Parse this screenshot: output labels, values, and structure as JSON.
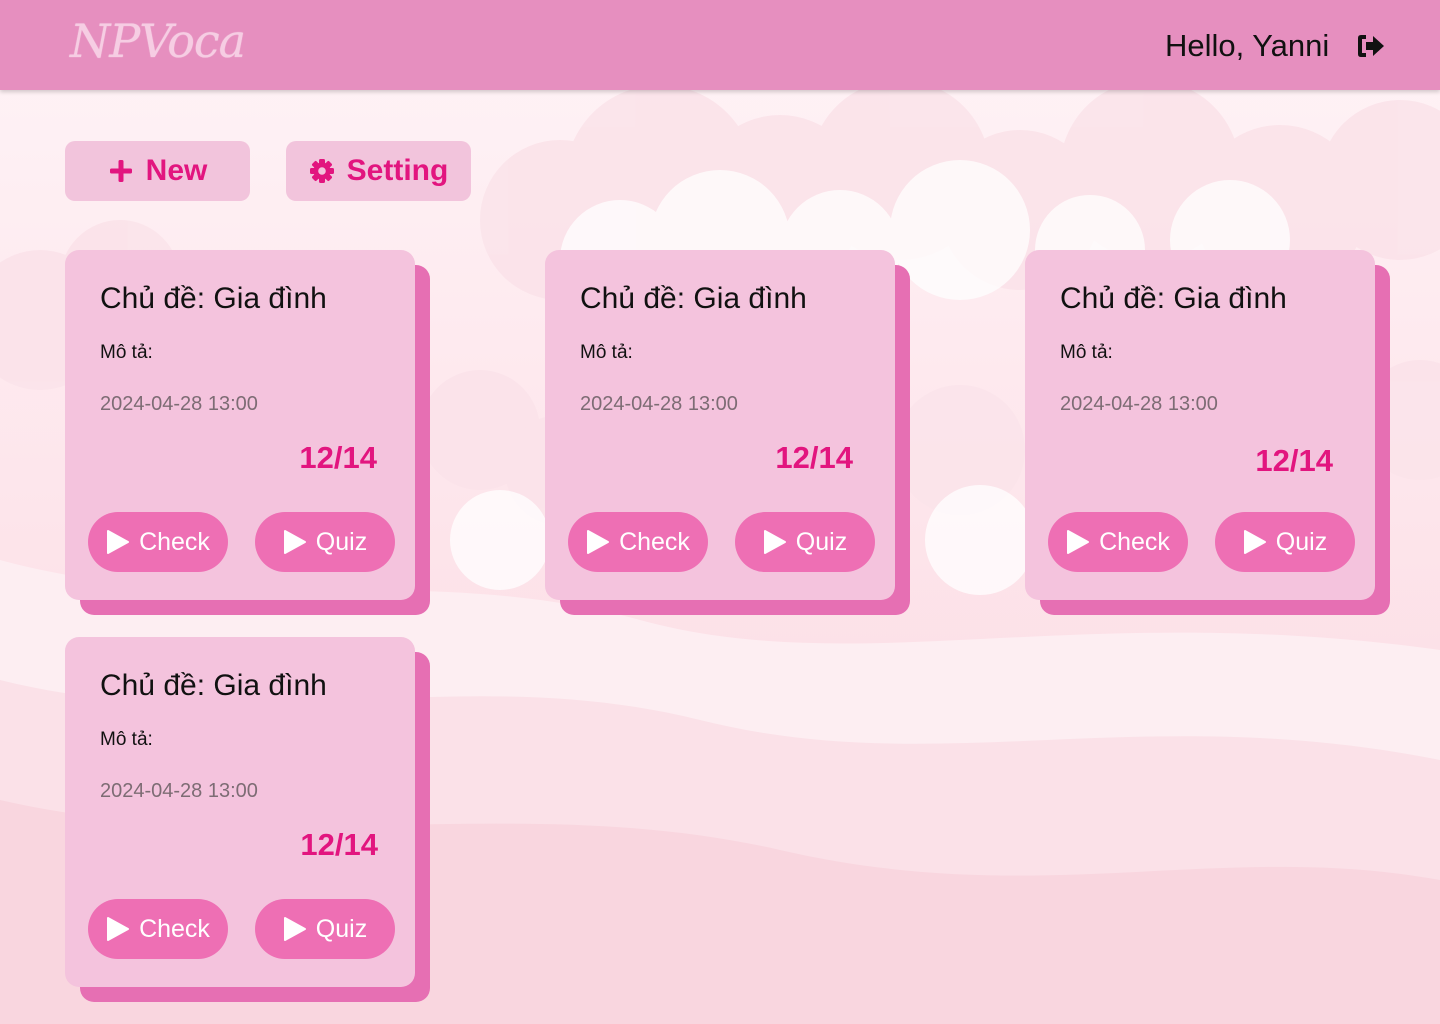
{
  "header": {
    "logo": "NPVoca",
    "greeting": "Hello, Yanni",
    "logout_icon": "logout-icon"
  },
  "toolbar": {
    "new_label": "New",
    "new_icon": "plus-icon",
    "setting_label": "Setting",
    "setting_icon": "gear-icon"
  },
  "colors": {
    "header_bg": "#e68fbf",
    "accent": "#e2157f",
    "card_bg": "#f4c3dd",
    "card_shadow": "#e66fb3",
    "button_bg": "#ee6fb4"
  },
  "cards": [
    {
      "title": "Chủ đề: Gia đình",
      "description": "Mô tả:",
      "date": "2024-04-28 13:00",
      "score": "12/14",
      "check_label": "Check",
      "quiz_label": "Quiz"
    },
    {
      "title": "Chủ đề: Gia đình",
      "description": "Mô tả:",
      "date": "2024-04-28 13:00",
      "score": "12/14",
      "check_label": "Check",
      "quiz_label": "Quiz"
    },
    {
      "title": "Chủ đề: Gia đình",
      "description": "Mô tả:",
      "date": "2024-04-28 13:00",
      "score": "12/14",
      "check_label": "Check",
      "quiz_label": "Quiz"
    },
    {
      "title": "Chủ đề: Gia đình",
      "description": "Mô tả:",
      "date": "2024-04-28 13:00",
      "score": "12/14",
      "check_label": "Check",
      "quiz_label": "Quiz"
    }
  ]
}
